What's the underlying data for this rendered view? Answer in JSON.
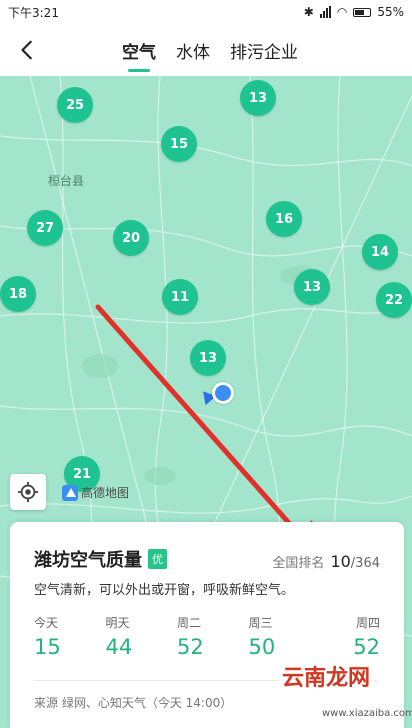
{
  "status": {
    "time": "下午3:21",
    "battery": "55%"
  },
  "tabs": [
    {
      "label": "空气",
      "active": true
    },
    {
      "label": "水体",
      "active": false
    },
    {
      "label": "排污企业",
      "active": false
    }
  ],
  "map": {
    "county_label": "桓台县",
    "logo_text": "高德地图",
    "markers": [
      "25",
      "13",
      "15",
      "16",
      "27",
      "20",
      "14",
      "18",
      "11",
      "13",
      "22",
      "13",
      "21"
    ]
  },
  "card": {
    "title": "潍坊空气质量",
    "grade": "优",
    "rank_label": "全国排名",
    "rank_value": "10",
    "rank_total": "/364",
    "advice": "空气清新，可以外出或开窗，呼吸新鲜空气。",
    "forecast": [
      {
        "day": "今天",
        "value": "15"
      },
      {
        "day": "明天",
        "value": "44"
      },
      {
        "day": "周二",
        "value": "52"
      },
      {
        "day": "周三",
        "value": "50"
      },
      {
        "day": "周四",
        "value": "52"
      }
    ],
    "source": "来源 绿网、心知天气（今天 14:00）"
  },
  "watermark": {
    "text": "云南龙网",
    "sub": "www.xiazaiba.com"
  },
  "colors": {
    "accent": "#1fc391",
    "map_bg": "#a3e5cc",
    "arrow": "#e0322a"
  }
}
